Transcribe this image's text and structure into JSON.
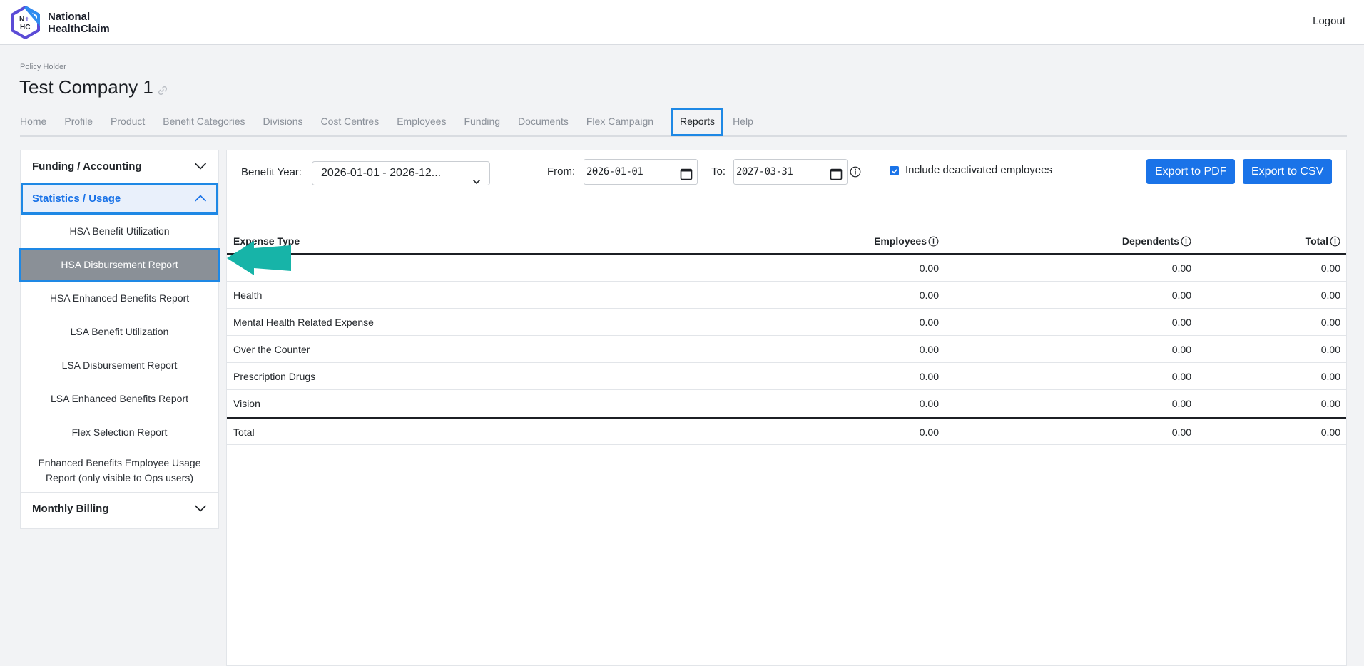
{
  "brand": {
    "name_line1": "National",
    "name_line2": "HealthClaim",
    "badge_top": "N",
    "badge_bottom": "HC",
    "accent": "#1a73e8"
  },
  "header": {
    "logout_label": "Logout"
  },
  "policy": {
    "label": "Policy Holder",
    "title": "Test Company 1"
  },
  "nav": {
    "items": [
      {
        "label": "Home"
      },
      {
        "label": "Profile"
      },
      {
        "label": "Product"
      },
      {
        "label": "Benefit Categories"
      },
      {
        "label": "Divisions"
      },
      {
        "label": "Cost Centres"
      },
      {
        "label": "Employees"
      },
      {
        "label": "Funding"
      },
      {
        "label": "Documents"
      },
      {
        "label": "Flex Campaign"
      },
      {
        "label": "Reports",
        "active": true
      },
      {
        "label": "Help"
      }
    ]
  },
  "sidebar": {
    "sections": [
      {
        "label": "Funding / Accounting"
      },
      {
        "label": "Statistics / Usage"
      },
      {
        "label": "Monthly Billing"
      }
    ],
    "items": [
      {
        "label": "HSA Benefit Utilization"
      },
      {
        "label": "HSA Disbursement Report"
      },
      {
        "label": "HSA Enhanced Benefits Report"
      },
      {
        "label": "LSA Benefit Utilization"
      },
      {
        "label": "LSA Disbursement Report"
      },
      {
        "label": "LSA Enhanced Benefits Report"
      },
      {
        "label": "Flex Selection Report"
      },
      {
        "label": "Enhanced Benefits Employee Usage Report (only visible to Ops users)"
      }
    ]
  },
  "filters": {
    "benefit_year_label": "Benefit Year:",
    "benefit_year_value": "2026-01-01 - 2026-12...",
    "from_label": "From:",
    "from_value": "2026-01-01",
    "to_label": "To:",
    "to_value": "2027-03-31",
    "include_deactivated_label": "Include deactivated employees",
    "include_deactivated_checked": true,
    "export_pdf_label": "Export to PDF",
    "export_csv_label": "Export to CSV"
  },
  "table": {
    "headers": [
      "Expense Type",
      "Employees",
      "Dependents",
      "Total"
    ],
    "rows": [
      [
        "",
        "0.00",
        "0.00",
        "0.00"
      ],
      [
        "Health",
        "0.00",
        "0.00",
        "0.00"
      ],
      [
        "Mental Health Related Expense",
        "0.00",
        "0.00",
        "0.00"
      ],
      [
        "Over the Counter",
        "0.00",
        "0.00",
        "0.00"
      ],
      [
        "Prescription Drugs",
        "0.00",
        "0.00",
        "0.00"
      ],
      [
        "Vision",
        "0.00",
        "0.00",
        "0.00"
      ]
    ],
    "total": [
      "Total",
      "0.00",
      "0.00",
      "0.00"
    ]
  }
}
